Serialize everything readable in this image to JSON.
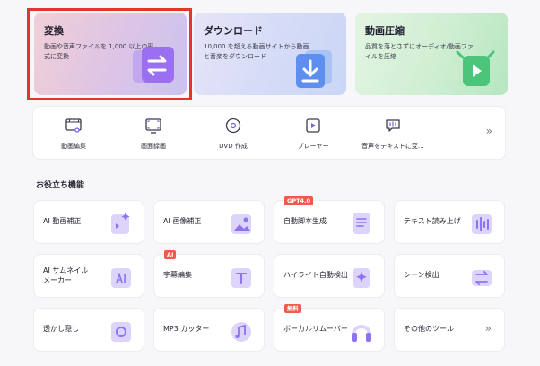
{
  "hero": {
    "convert": {
      "title": "変換",
      "desc": "動画や音声ファイルを 1,000 以上の形式に変換"
    },
    "download": {
      "title": "ダウンロード",
      "desc": "10,000 を超える動画サイトから動画と音楽をダウンロード"
    },
    "compress": {
      "title": "動画圧縮",
      "desc": "品質を落とさずにオーディオ/動画ファイルを圧縮"
    }
  },
  "tools": {
    "items": [
      {
        "label": "動画編集",
        "icon": "video-edit-icon"
      },
      {
        "label": "画面録画",
        "icon": "screen-record-icon"
      },
      {
        "label": "DVD 作成",
        "icon": "dvd-icon"
      },
      {
        "label": "プレーヤー",
        "icon": "player-icon"
      },
      {
        "label": "音声をテキストに変…",
        "icon": "speech-to-text-icon"
      }
    ],
    "more": "»"
  },
  "section": {
    "title": "お役立ち機能"
  },
  "cards": [
    {
      "label": "AI 動画補正",
      "icon": "ai-video-enhance-icon"
    },
    {
      "label": "AI 画像補正",
      "icon": "ai-image-enhance-icon"
    },
    {
      "label": "自動脚本生成",
      "badge": "GPT4.0",
      "icon": "script-generator-icon"
    },
    {
      "label": "テキスト読み上げ",
      "icon": "text-to-speech-icon"
    },
    {
      "label1": "AI サムネイル",
      "label2": "メーカー",
      "icon": "ai-thumbnail-icon"
    },
    {
      "label": "字幕編集",
      "badge": "AI",
      "icon": "subtitle-edit-icon"
    },
    {
      "label": "ハイライト自動検出",
      "icon": "highlight-detect-icon"
    },
    {
      "label": "シーン検出",
      "icon": "scene-detect-icon"
    },
    {
      "label": "透かし隠し",
      "icon": "watermark-remove-icon"
    },
    {
      "label": "MP3 カッター",
      "icon": "mp3-cutter-icon"
    },
    {
      "label": "ボーカルリムーバー",
      "badge": "無料",
      "icon": "vocal-remover-icon"
    },
    {
      "label": "その他のツール",
      "more": "»"
    }
  ],
  "colors": {
    "accent": "#7b5cf0",
    "badge": "#ef5a4c",
    "selection": "#e2352b"
  }
}
